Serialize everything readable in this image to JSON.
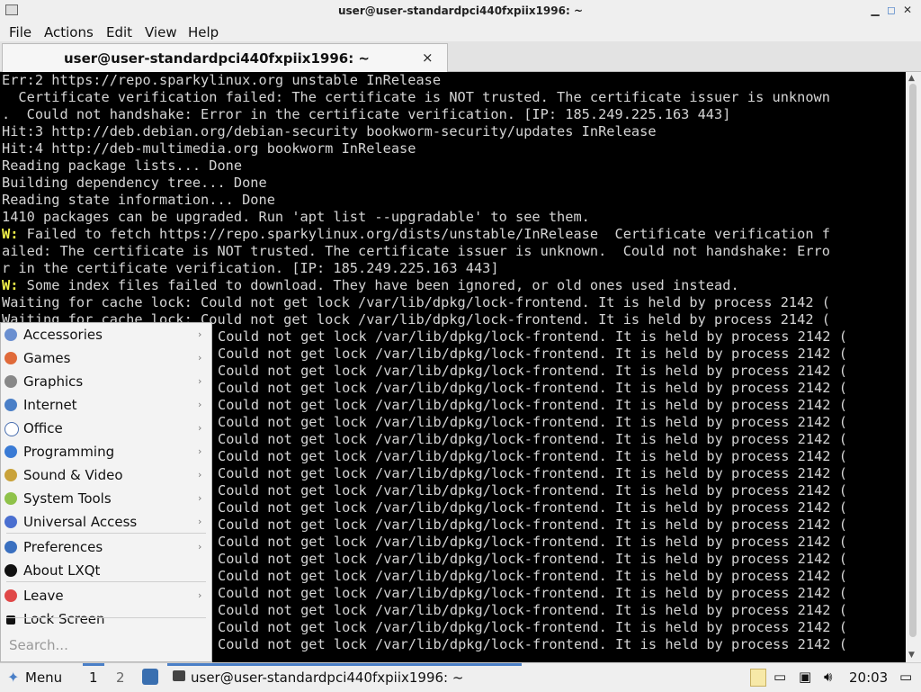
{
  "window": {
    "title": "user@user-standardpci440fxpiix1996: ~"
  },
  "menubar": [
    "File",
    "Actions",
    "Edit",
    "View",
    "Help"
  ],
  "tab": {
    "label": "user@user-standardpci440fxpiix1996: ~",
    "close": "×"
  },
  "terminal": {
    "lines": [
      "Err:2 https://repo.sparkylinux.org unstable InRelease",
      "  Certificate verification failed: The certificate is NOT trusted. The certificate issuer is unknown",
      ".  Could not handshake: Error in the certificate verification. [IP: 185.249.225.163 443]",
      "Hit:3 http://deb.debian.org/debian-security bookworm-security/updates InRelease",
      "Hit:4 http://deb-multimedia.org bookworm InRelease",
      "Reading package lists... Done",
      "Building dependency tree... Done",
      "Reading state information... Done",
      "1410 packages can be upgraded. Run 'apt list --upgradable' to see them.",
      " Failed to fetch https://repo.sparkylinux.org/dists/unstable/InRelease  Certificate verification f",
      "ailed: The certificate is NOT trusted. The certificate issuer is unknown.  Could not handshake: Erro",
      "r in the certificate verification. [IP: 185.249.225.163 443]",
      " Some index files failed to download. They have been ignored, or old ones used instead.",
      "Waiting for cache lock: Could not get lock /var/lib/dpkg/lock-frontend. It is held by process 2142 (",
      "Waiting for cache lock: Could not get lock /var/lib/dpkg/lock-frontend. It is held by process 2142 ("
    ],
    "warn_prefix": "W:",
    "warn_lines": [
      9,
      12
    ],
    "repeat_text": "Could not get lock /var/lib/dpkg/lock-frontend. It is held by process 2142 (",
    "repeat_count": 19
  },
  "startmenu": {
    "items": [
      {
        "label": "Accessories",
        "icon": "accessories-icon",
        "color": "#6a8fd0",
        "submenu": true
      },
      {
        "label": "Games",
        "icon": "games-icon",
        "color": "#e06a3a",
        "submenu": true
      },
      {
        "label": "Graphics",
        "icon": "graphics-icon",
        "color": "#888888",
        "submenu": true
      },
      {
        "label": "Internet",
        "icon": "internet-icon",
        "color": "#4a7fc7",
        "submenu": true
      },
      {
        "label": "Office",
        "icon": "office-icon",
        "color": "#ffffff",
        "submenu": true
      },
      {
        "label": "Programming",
        "icon": "programming-icon",
        "color": "#3a7bd5",
        "submenu": true
      },
      {
        "label": "Sound & Video",
        "icon": "sound-video-icon",
        "color": "#c9a23a",
        "submenu": true
      },
      {
        "label": "System Tools",
        "icon": "system-tools-icon",
        "color": "#8fc24a",
        "submenu": true
      },
      {
        "label": "Universal Access",
        "icon": "universal-access-icon",
        "color": "#4a6fd0",
        "submenu": true
      },
      {
        "label": "Preferences",
        "icon": "preferences-icon",
        "color": "#3a70c0",
        "submenu": true
      },
      {
        "label": "About LXQt",
        "icon": "info-icon",
        "color": "#111111",
        "submenu": false
      },
      {
        "label": "Leave",
        "icon": "leave-icon",
        "color": "#e04848",
        "submenu": true
      },
      {
        "label": "Lock Screen",
        "icon": "lock-icon",
        "color": "#111111",
        "submenu": false
      }
    ],
    "search_placeholder": "Search..."
  },
  "taskbar": {
    "menu_label": "Menu",
    "desktops": [
      "1",
      "2"
    ],
    "task_label": "user@user-standardpci440fxpiix1996: ~",
    "clock": "20:03"
  }
}
